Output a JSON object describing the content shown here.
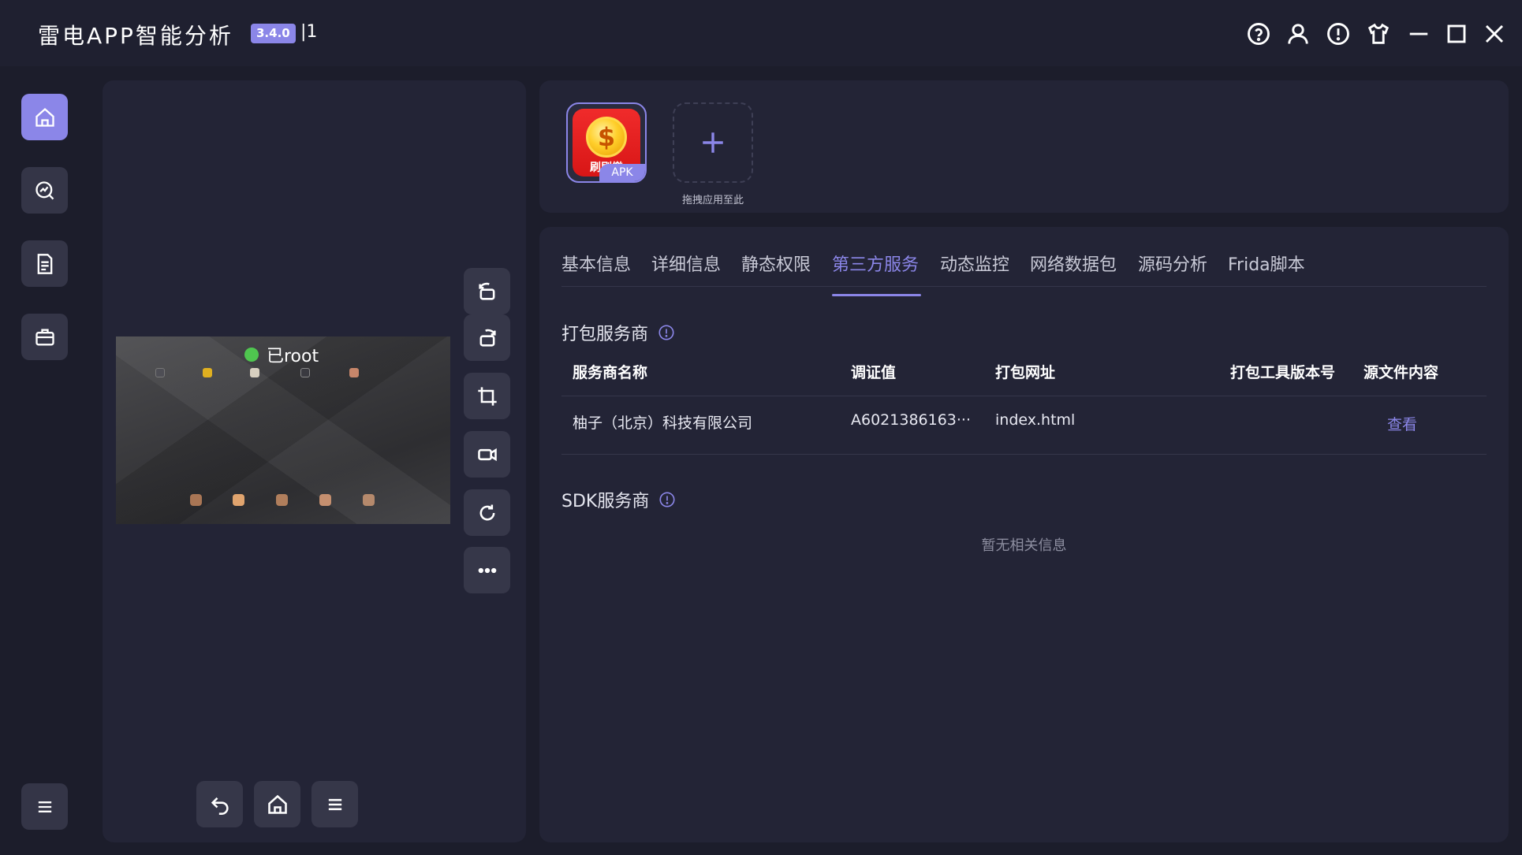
{
  "app": {
    "title": "雷电APP智能分析",
    "version": "3.4.0",
    "instance": "|1"
  },
  "window_controls": [
    "help-icon",
    "user-icon",
    "info-icon",
    "shirt-icon",
    "minimize-icon",
    "maximize-icon",
    "close-icon"
  ],
  "nav": [
    {
      "name": "home",
      "icon": "home-icon",
      "active": true
    },
    {
      "name": "analysis",
      "icon": "chart-search-icon",
      "active": false
    },
    {
      "name": "report",
      "icon": "document-icon",
      "active": false
    },
    {
      "name": "toolbox",
      "icon": "briefcase-icon",
      "active": false
    },
    {
      "name": "menu",
      "icon": "menu-icon",
      "active": false
    }
  ],
  "device": {
    "root_status": "已root",
    "side_tools": [
      "rotate-left-icon",
      "rotate-right-icon",
      "crop-icon",
      "record-icon",
      "refresh-icon",
      "more-icon"
    ],
    "bottom_tools": [
      "back-icon",
      "home-icon",
      "menu-icon"
    ]
  },
  "apps": {
    "current_app_label": "刷刷樂",
    "apk_tag": "APK",
    "drop_label": "拖拽应用至此"
  },
  "tabs": [
    {
      "label": "基本信息",
      "active": false
    },
    {
      "label": "详细信息",
      "active": false
    },
    {
      "label": "静态权限",
      "active": false
    },
    {
      "label": "第三方服务",
      "active": true
    },
    {
      "label": "动态监控",
      "active": false
    },
    {
      "label": "网络数据包",
      "active": false
    },
    {
      "label": "源码分析",
      "active": false
    },
    {
      "label": "Frida脚本",
      "active": false
    }
  ],
  "packaging": {
    "title": "打包服务商",
    "columns": [
      "服务商名称",
      "调证值",
      "打包网址",
      "打包工具版本号",
      "源文件内容"
    ],
    "rows": [
      {
        "provider": "柚子（北京）科技有限公司",
        "evidence": "A6021386163···",
        "url": "index.html",
        "tool_version": "",
        "action": "查看"
      }
    ]
  },
  "sdk": {
    "title": "SDK服务商",
    "empty_text": "暂无相关信息"
  },
  "colors": {
    "accent": "#8b86e8",
    "background": "#1c1d2b",
    "panel": "#232436",
    "root_green": "#4fc64f"
  }
}
